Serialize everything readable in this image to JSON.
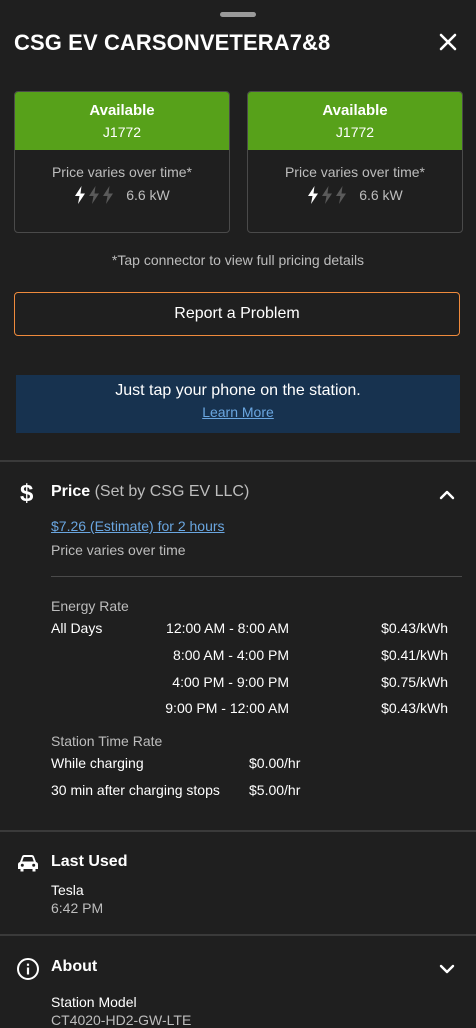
{
  "header": {
    "title": "CSG EV CARSONVETERA7&8",
    "close_icon": "close-icon"
  },
  "connectors": [
    {
      "status": "Available",
      "type": "J1772",
      "price_note": "Price varies over time*",
      "power": "6.6 kW",
      "power_level": 1,
      "power_levels_total": 3
    },
    {
      "status": "Available",
      "type": "J1772",
      "price_note": "Price varies over time*",
      "power": "6.6 kW",
      "power_level": 1,
      "power_levels_total": 3
    }
  ],
  "pricing_note": "*Tap connector to view full pricing details",
  "report_button": "Report a Problem",
  "banner": {
    "text": "Just tap your phone on the station.",
    "link": "Learn More"
  },
  "price_section": {
    "title": "Price",
    "subtitle": "(Set by CSG EV LLC)",
    "estimate_link": "$7.26 (Estimate) for 2 hours",
    "varies": "Price varies over time",
    "energy_rate_label": "Energy Rate",
    "energy_rates": [
      {
        "days": "All Days",
        "time": "12:00 AM - 8:00 AM",
        "rate": "$0.43/kWh"
      },
      {
        "days": "",
        "time": "8:00 AM - 4:00 PM",
        "rate": "$0.41/kWh"
      },
      {
        "days": "",
        "time": "4:00 PM - 9:00 PM",
        "rate": "$0.75/kWh"
      },
      {
        "days": "",
        "time": "9:00 PM - 12:00 AM",
        "rate": "$0.43/kWh"
      }
    ],
    "station_time_label": "Station Time Rate",
    "station_time_rates": [
      {
        "label": "While charging",
        "rate": "$0.00/hr"
      },
      {
        "label": "30 min after charging stops",
        "rate": "$5.00/hr"
      }
    ]
  },
  "last_used": {
    "title": "Last Used",
    "vehicle": "Tesla",
    "time": "6:42 PM"
  },
  "about": {
    "title": "About",
    "station_model_label": "Station Model",
    "station_model": "CT4020-HD2-GW-LTE"
  },
  "colors": {
    "background": "#1f1f1f",
    "available_green": "#57a11a",
    "report_border": "#ee8a3c",
    "banner_bg": "#17324f",
    "link_blue": "#6aa6e0"
  }
}
